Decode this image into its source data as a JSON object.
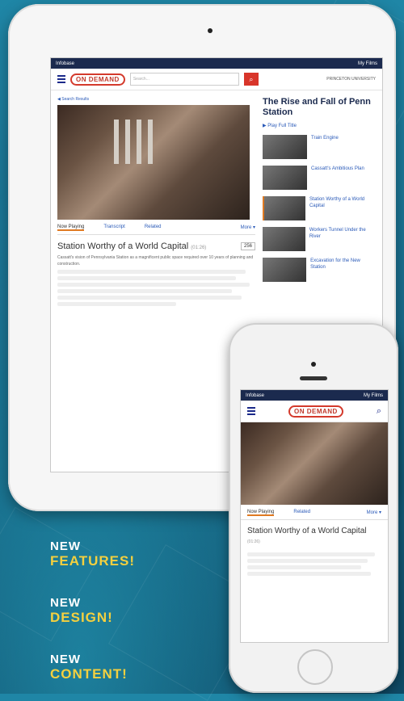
{
  "tablet": {
    "topbar": {
      "brand": "Infobase",
      "account": "My Films"
    },
    "logo_text": "ON DEMAND",
    "search_placeholder": "Search...",
    "institution": "PRINCETON UNIVERSITY",
    "breadcrumb": "◀ Search Results",
    "tabs": {
      "now_playing": "Now Playing",
      "transcript": "Transcript",
      "related": "Related",
      "more": "More ▾"
    },
    "segment_title": "Station Worthy of a World Capital",
    "segment_time": "(01:26)",
    "count": "256",
    "description": "Cassatt's vision of Pennsylvania Station as a magnificent public space required over 10 years of planning and construction.",
    "sidebar": {
      "title": "The Rise and Fall of Penn Station",
      "play_full": "▶ Play Full Title",
      "clips": [
        {
          "title": "Train Engine"
        },
        {
          "title": "Cassatt's Ambitious Plan"
        },
        {
          "title": "Station Worthy of a World Capital"
        },
        {
          "title": "Workers Tunnel Under the River"
        },
        {
          "title": "Excavation for the New Station"
        }
      ]
    }
  },
  "phone": {
    "segment_title": "Station Worthy of a World Capital",
    "segment_time": "(01:26)",
    "tabs": {
      "now_playing": "Now Playing",
      "related": "Related",
      "more": "More ▾"
    }
  },
  "promo": {
    "line1_new": "NEW",
    "line1_word": "FEATURES!",
    "line2_new": "NEW",
    "line2_word": "DESIGN!",
    "line3_new": "NEW",
    "line3_word": "CONTENT!"
  }
}
